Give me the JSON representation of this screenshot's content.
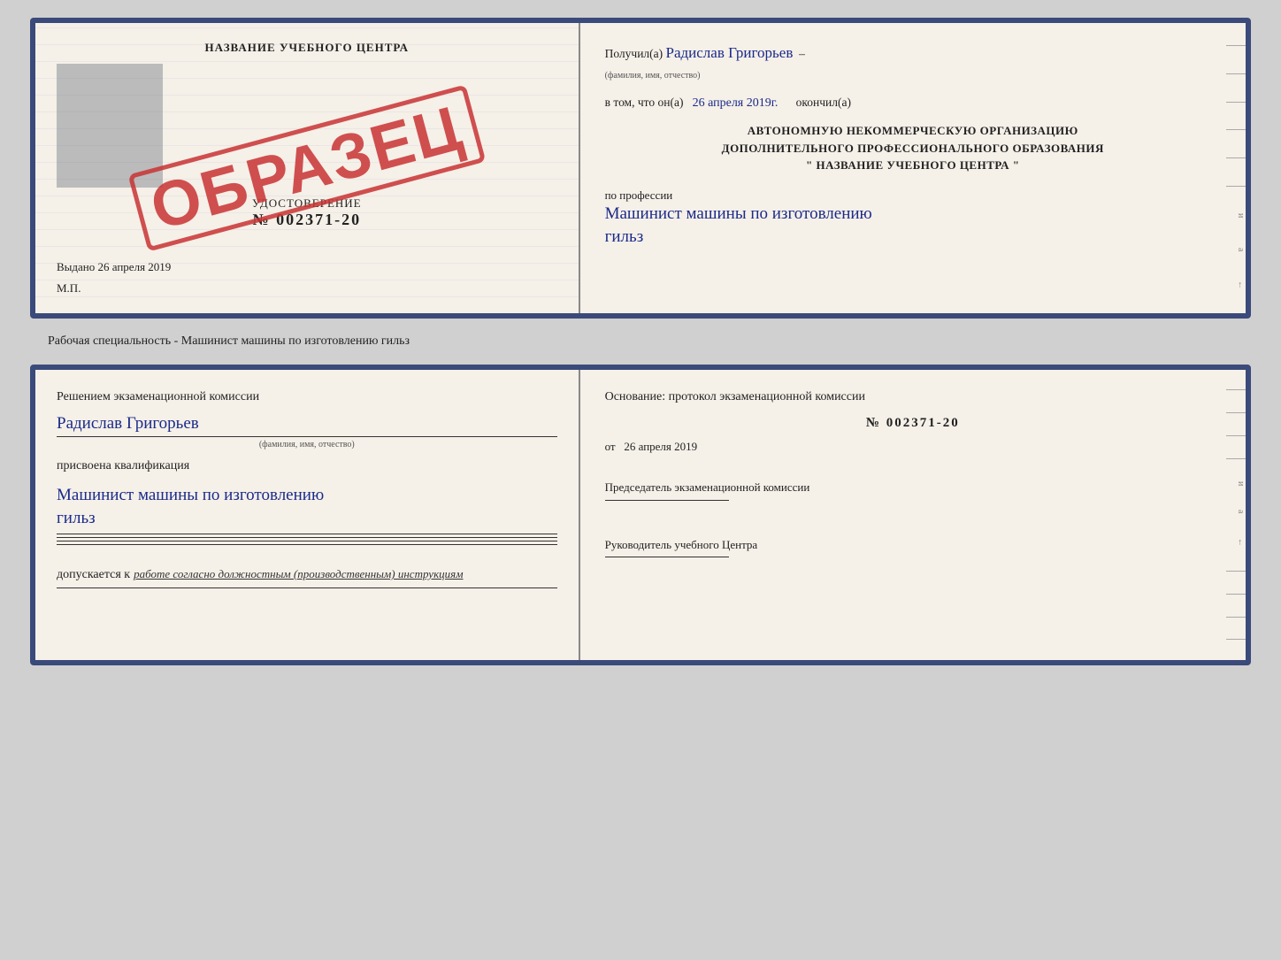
{
  "doc1": {
    "left": {
      "title": "НАЗВАНИЕ УЧЕБНОГО ЦЕНТРА",
      "cert_label": "УДОСТОВЕРЕНИЕ",
      "cert_number": "№ 002371-20",
      "issued_prefix": "Выдано",
      "issued_date": "26 апреля 2019",
      "mp_label": "М.П.",
      "stamp_text": "ОБРАЗЕЦ"
    },
    "right": {
      "received_prefix": "Получил(а)",
      "recipient_name": "Радислав Григорьев",
      "recipient_caption": "(фамилия, имя, отчество)",
      "in_that_prefix": "в том, что он(а)",
      "completion_date": "26 апреля 2019г.",
      "completed_suffix": "окончил(а)",
      "org_line1": "АВТОНОМНУЮ НЕКОММЕРЧЕСКУЮ ОРГАНИЗАЦИЮ",
      "org_line2": "ДОПОЛНИТЕЛЬНОГО ПРОФЕССИОНАЛЬНОГО ОБРАЗОВАНИЯ",
      "org_name": "\" НАЗВАНИЕ УЧЕБНОГО ЦЕНТРА \"",
      "profession_prefix": "по профессии",
      "profession_name": "Машинист машины по изготовлению",
      "profession_name2": "гильз"
    }
  },
  "caption": "Рабочая специальность - Машинист машины по изготовлению гильз",
  "doc2": {
    "left": {
      "decision_text": "Решением  экзаменационной  комиссии",
      "person_name": "Радислав Григорьев",
      "person_caption": "(фамилия, имя, отчество)",
      "assigned_label": "присвоена квалификация",
      "qualification_name": "Машинист машины по изготовлению",
      "qualification_name2": "гильз",
      "allowed_prefix": "допускается к",
      "allowed_text": "работе согласно должностным (производственным) инструкциям"
    },
    "right": {
      "osnov_label": "Основание: протокол экзаменационной  комиссии",
      "protocol_number": "№  002371-20",
      "date_prefix": "от",
      "date_value": "26 апреля 2019",
      "chairman_title": "Председатель экзаменационной комиссии",
      "director_title": "Руководитель учебного Центра"
    }
  }
}
